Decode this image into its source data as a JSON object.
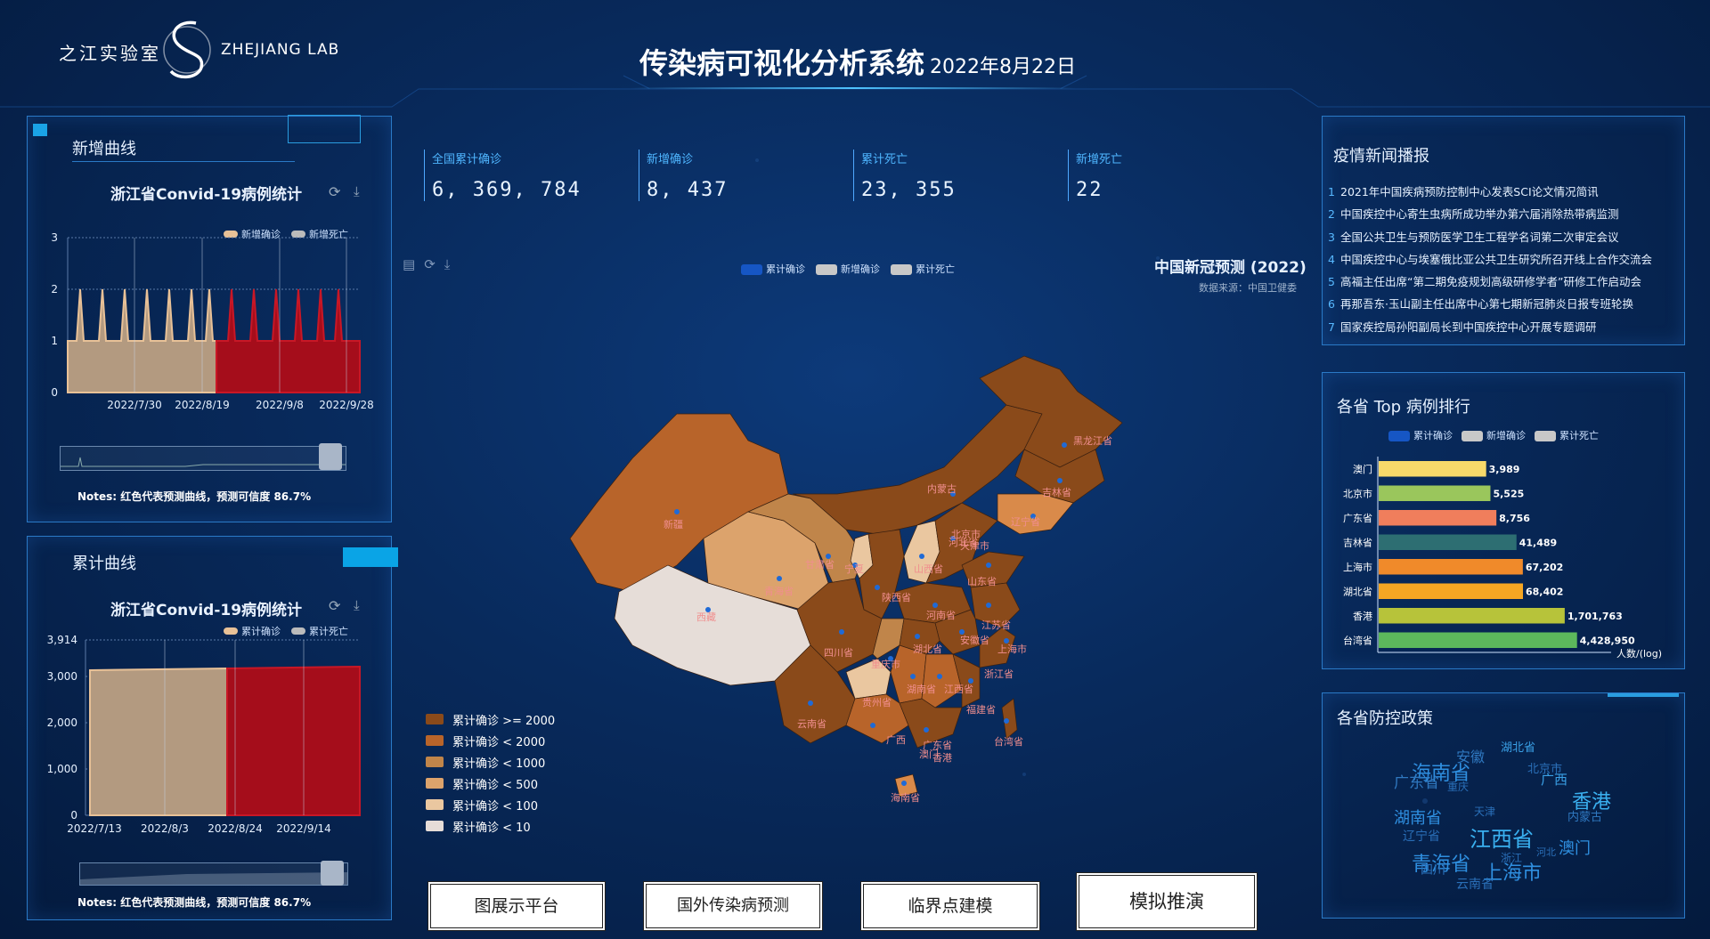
{
  "header": {
    "logo_cn": "之江实验室",
    "logo_en": "ZHEJIANG LAB",
    "title": "传染病可视化分析系统",
    "date": "2022年8月22日"
  },
  "stats": [
    {
      "label": "全国累计确诊",
      "value": "6, 369, 784"
    },
    {
      "label": "新增确诊",
      "value": "8, 437"
    },
    {
      "label": "累计死亡",
      "value": "23, 355"
    },
    {
      "label": "新增死亡",
      "value": "22"
    }
  ],
  "new_curve": {
    "panel_title": "新增曲线",
    "chart_title": "浙江省Convid-19病例统计",
    "legend": [
      "新增确诊",
      "新增死亡"
    ],
    "notes": "Notes: 红色代表预测曲线，预测可信度 86.7%"
  },
  "cum_curve": {
    "panel_title": "累计曲线",
    "chart_title": "浙江省Convid-19病例统计",
    "legend": [
      "累计确诊",
      "累计死亡"
    ],
    "notes": "Notes: 红色代表预测曲线，预测可信度 86.7%"
  },
  "map": {
    "title": "中国新冠预测 (2022)",
    "source": "数据来源：中国卫健委",
    "legend_top": [
      "累计确诊",
      "新增确诊",
      "累计死亡"
    ],
    "legend_colors": [
      "#1656c4",
      "#c8c8c8",
      "#c8c8c8"
    ],
    "scale": [
      {
        "label": "累计确诊 >= 2000",
        "color": "#8a4a1a"
      },
      {
        "label": "累计确诊 < 2000",
        "color": "#b8642a"
      },
      {
        "label": "累计确诊 < 1000",
        "color": "#c0854a"
      },
      {
        "label": "累计确诊 < 500",
        "color": "#dca36c"
      },
      {
        "label": "累计确诊 < 100",
        "color": "#eac7a0"
      },
      {
        "label": "累计确诊 < 10",
        "color": "#e6ddd8"
      }
    ],
    "provinces": [
      "黑龙江省",
      "吉林省",
      "辽宁省",
      "内蒙古",
      "北京市",
      "天津市",
      "河北省",
      "山西省",
      "山东省",
      "新疆",
      "甘肃省",
      "青海省",
      "宁夏",
      "陕西省",
      "河南省",
      "江苏省",
      "安徽省",
      "上海市",
      "西藏",
      "四川省",
      "湖北省",
      "重庆市",
      "浙江省",
      "湖南省",
      "江西省",
      "贵州省",
      "福建省",
      "云南省",
      "广西",
      "广东省",
      "台湾省",
      "香港",
      "澳门",
      "海南省"
    ]
  },
  "news": {
    "title": "疫情新闻播报",
    "items": [
      "2021年中国疾病预防控制中心发表SCI论文情况简讯",
      "中国疾控中心寄生虫病所成功举办第六届消除热带病监测",
      "全国公共卫生与预防医学卫生工程学名词第二次审定会议",
      "中国疾控中心与埃塞俄比亚公共卫生研究所召开线上合作交流会",
      "高福主任出席“第二期免疫规划高级研修学者”研修工作启动会",
      "再那吾东·玉山副主任出席中心第七期新冠肺炎日报专班轮换",
      "国家疾控局孙阳副局长到中国疾控中心开展专题调研"
    ]
  },
  "ranking": {
    "title": "各省 Top 病例排行",
    "legend": [
      "累计确诊",
      "新增确诊",
      "累计死亡"
    ],
    "unit": "人数/(log)",
    "chart_data": {
      "type": "bar",
      "orientation": "horizontal",
      "categories": [
        "澳门",
        "北京市",
        "广东省",
        "吉林省",
        "上海市",
        "湖北省",
        "香港",
        "台湾省"
      ],
      "labels": [
        "3,989",
        "5,525",
        "8,756",
        "41,489",
        "67,202",
        "68,402",
        "1,701,763",
        "4,428,950"
      ],
      "values": [
        8.29,
        8.62,
        9.08,
        10.63,
        11.12,
        11.13,
        14.35,
        15.3
      ],
      "colors": [
        "#f7d96a",
        "#9ac65c",
        "#f07e5c",
        "#2d6e72",
        "#f08a2a",
        "#f5a623",
        "#b7c33a",
        "#5cb85c"
      ],
      "xlim": [
        0,
        18
      ],
      "xticks": [
        0,
        3,
        6,
        9,
        12,
        15,
        18
      ]
    }
  },
  "policy": {
    "title": "各省防控政策",
    "words": [
      {
        "t": "湖北省",
        "c": "#3aa0e6"
      },
      {
        "t": "安徽",
        "c": "#2f78c0"
      },
      {
        "t": "海南省",
        "c": "#2f8fe0"
      },
      {
        "t": "北京市",
        "c": "#2a6fb8"
      },
      {
        "t": "广西",
        "c": "#3aa0e6"
      },
      {
        "t": "广东省",
        "c": "#2f78c0"
      },
      {
        "t": "重庆",
        "c": "#2a6fb8"
      },
      {
        "t": "香港",
        "c": "#3ab0f0"
      },
      {
        "t": "湖南省",
        "c": "#2f8fe0"
      },
      {
        "t": "天津",
        "c": "#2a6fb8"
      },
      {
        "t": "内蒙古",
        "c": "#2f78c0"
      },
      {
        "t": "辽宁省",
        "c": "#2a6fb8"
      },
      {
        "t": "江西省",
        "c": "#3ab0f0"
      },
      {
        "t": "澳门",
        "c": "#2f8fe0"
      },
      {
        "t": "河北",
        "c": "#2a6fb8"
      },
      {
        "t": "青海省",
        "c": "#2f8fe0"
      },
      {
        "t": "浙江",
        "c": "#2a6fb8"
      },
      {
        "t": "四川",
        "c": "#2a6fb8"
      },
      {
        "t": "上海市",
        "c": "#2f8fe0"
      },
      {
        "t": "云南省",
        "c": "#2a6fb8"
      }
    ]
  },
  "buttons": [
    "图展示平台",
    "国外传染病预测",
    "临界点建模",
    "模拟推演"
  ]
}
